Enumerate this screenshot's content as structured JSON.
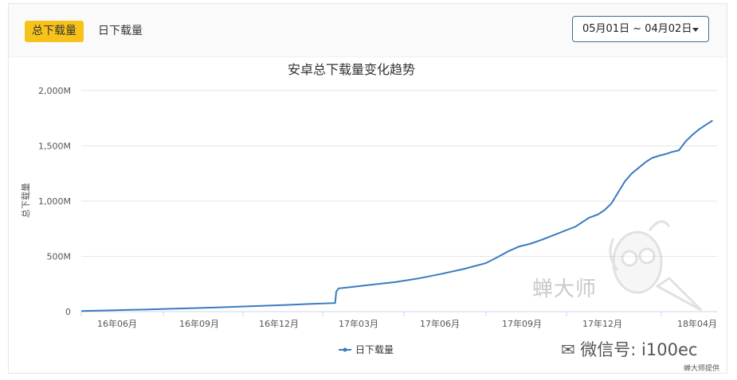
{
  "tabs": {
    "total_label": "总下载量",
    "daily_label": "日下载量"
  },
  "date_range": {
    "label": "05月01日 ~ 04月02日"
  },
  "watermark": {
    "brand": "蝉大师",
    "wechat": "微信号: i100ec",
    "credit": "蝉大师提供"
  },
  "colors": {
    "accent": "#f7c31a",
    "line": "#3a7bbf",
    "button_border": "#3a6f96"
  },
  "chart_data": {
    "type": "line",
    "title": "安卓总下载量变化趋势",
    "ylabel": "总下载量",
    "xlabel": "",
    "y_ticks": [
      {
        "value": 0,
        "label": "0"
      },
      {
        "value": 500,
        "label": "500M"
      },
      {
        "value": 1000,
        "label": "1,000M"
      },
      {
        "value": 1500,
        "label": "1,500M"
      },
      {
        "value": 2000,
        "label": "2,000M"
      }
    ],
    "ylim": [
      0,
      2000
    ],
    "x_ticks": [
      {
        "value": 0.4,
        "label": "16年06月"
      },
      {
        "value": 3.4,
        "label": "16年09月"
      },
      {
        "value": 6.4,
        "label": "16年12月"
      },
      {
        "value": 9.4,
        "label": "17年03月"
      },
      {
        "value": 12.4,
        "label": "17年06月"
      },
      {
        "value": 15.4,
        "label": "17年09月"
      },
      {
        "value": 18.4,
        "label": "17年12月"
      },
      {
        "value": 21.4,
        "label": "18年04月"
      }
    ],
    "xlim": [
      0,
      23.3
    ],
    "legend": {
      "position": "bottom"
    },
    "series": [
      {
        "name": "日下载量",
        "points": [
          [
            0,
            5
          ],
          [
            1,
            10
          ],
          [
            2,
            15
          ],
          [
            3,
            20
          ],
          [
            4,
            26
          ],
          [
            5,
            32
          ],
          [
            6,
            38
          ],
          [
            7,
            45
          ],
          [
            8,
            52
          ],
          [
            9,
            60
          ],
          [
            10,
            68
          ],
          [
            11.3,
            78
          ],
          [
            11.35,
            180
          ],
          [
            11.45,
            210
          ],
          [
            12,
            222
          ],
          [
            13,
            245
          ],
          [
            14,
            268
          ],
          [
            15,
            300
          ],
          [
            16,
            340
          ],
          [
            17,
            385
          ],
          [
            18,
            438
          ],
          [
            18.5,
            490
          ],
          [
            19,
            545
          ],
          [
            19.5,
            590
          ],
          [
            20,
            615
          ],
          [
            20.5,
            650
          ],
          [
            21,
            690
          ],
          [
            21.5,
            730
          ],
          [
            22,
            770
          ],
          [
            22.3,
            810
          ],
          [
            22.6,
            850
          ],
          [
            23,
            880
          ],
          [
            23.3,
            920
          ],
          [
            23.6,
            980
          ],
          [
            23.9,
            1080
          ],
          [
            24.2,
            1180
          ],
          [
            24.5,
            1250
          ],
          [
            24.8,
            1300
          ],
          [
            25.1,
            1350
          ],
          [
            25.4,
            1390
          ],
          [
            25.7,
            1410
          ],
          [
            26,
            1425
          ],
          [
            26.3,
            1445
          ],
          [
            26.6,
            1460
          ],
          [
            26.9,
            1540
          ],
          [
            27.2,
            1600
          ],
          [
            27.5,
            1650
          ],
          [
            27.8,
            1690
          ],
          [
            28.1,
            1730
          ]
        ]
      }
    ]
  }
}
